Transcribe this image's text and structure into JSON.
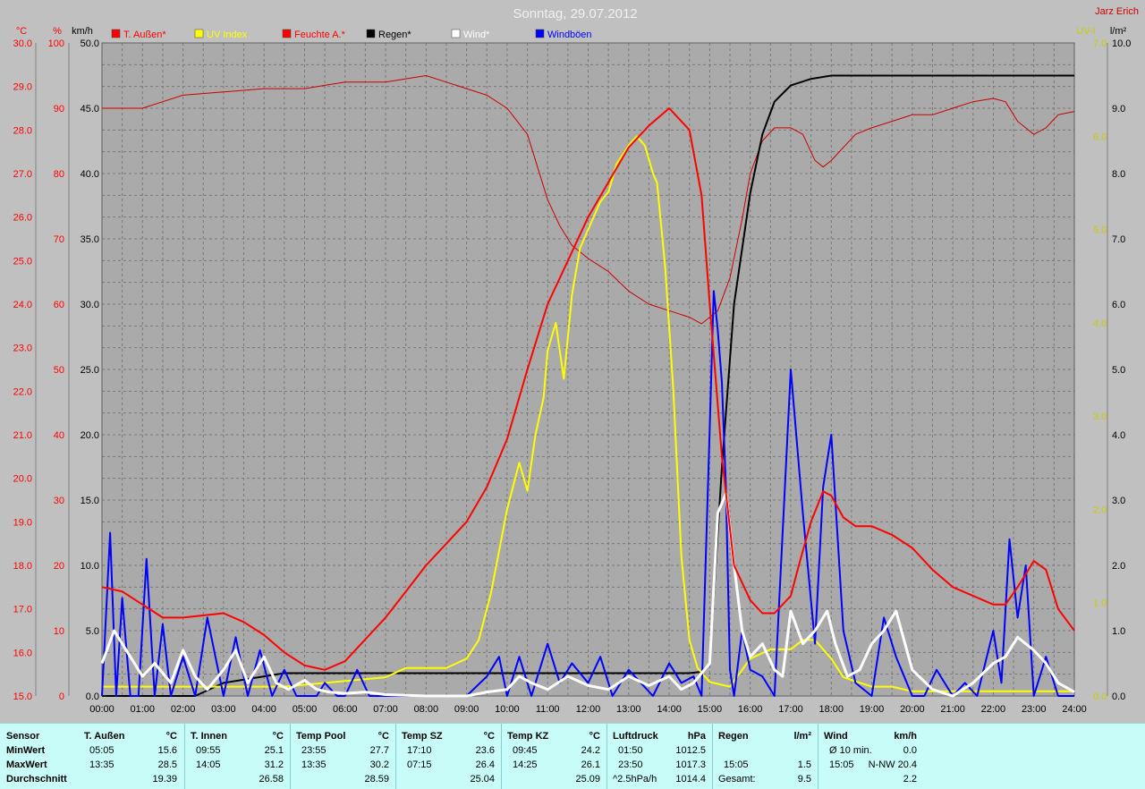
{
  "header": {
    "date_title": "Sonntag, 29.07.2012",
    "author": "Jarz Erich"
  },
  "colors": {
    "temp": "#ff0000",
    "humidity": "#cc0000",
    "uv": "#ffff00",
    "rain": "#000000",
    "wind": "#ffffff",
    "gusts": "#0000ff",
    "plot_bg": "#aaaaaa",
    "page_bg": "#c0c0c0",
    "stats_bg": "#c8fcf8"
  },
  "chart_data": {
    "type": "line",
    "x_unit": "time",
    "x_range": [
      "00:00",
      "24:00"
    ],
    "x_ticks": [
      "00:00",
      "01:00",
      "02:00",
      "03:00",
      "04:00",
      "05:00",
      "06:00",
      "07:00",
      "08:00",
      "09:00",
      "10:00",
      "11:00",
      "12:00",
      "13:00",
      "14:00",
      "15:00",
      "16:00",
      "17:00",
      "18:00",
      "19:00",
      "20:00",
      "21:00",
      "22:00",
      "23:00",
      "24:00"
    ],
    "grid": true,
    "legend_position": "top",
    "axes": {
      "temp": {
        "unit": "°C",
        "range": [
          15,
          30
        ],
        "ticks": [
          "15.0",
          "16.0",
          "17.0",
          "18.0",
          "19.0",
          "20.0",
          "21.0",
          "22.0",
          "23.0",
          "24.0",
          "25.0",
          "26.0",
          "27.0",
          "28.0",
          "29.0",
          "30.0"
        ],
        "color": "#ff0000"
      },
      "humidity": {
        "unit": "%",
        "range": [
          0,
          100
        ],
        "ticks": [
          "0",
          "10",
          "20",
          "30",
          "40",
          "50",
          "60",
          "70",
          "80",
          "90",
          "100"
        ],
        "color": "#ff0000"
      },
      "wind": {
        "unit": "km/h",
        "range": [
          0,
          50
        ],
        "ticks": [
          "0.0",
          "5.0",
          "10.0",
          "15.0",
          "20.0",
          "25.0",
          "30.0",
          "35.0",
          "40.0",
          "45.0",
          "50.0"
        ],
        "color": "#000000"
      },
      "uv": {
        "unit": "UV-I",
        "range": [
          0,
          7
        ],
        "ticks": [
          "0.0",
          "1.0",
          "2.0",
          "3.0",
          "4.0",
          "5.0",
          "6.0",
          "7.0"
        ],
        "color": "#cccc00"
      },
      "rain": {
        "unit": "l/m²",
        "range": [
          0,
          10
        ],
        "ticks": [
          "0.0",
          "1.0",
          "2.0",
          "3.0",
          "4.0",
          "5.0",
          "6.0",
          "7.0",
          "8.0",
          "9.0",
          "10.0"
        ],
        "color": "#000000"
      }
    },
    "legend": [
      {
        "name": "T. Außen*",
        "color": "#ff0000"
      },
      {
        "name": "UV Index",
        "color": "#ffff00"
      },
      {
        "name": "Feuchte A.*",
        "color": "#ff0000"
      },
      {
        "name": "Regen*",
        "color": "#000000"
      },
      {
        "name": "Wind*",
        "color": "#ffffff"
      },
      {
        "name": "Windböen",
        "color": "#0000ff"
      }
    ],
    "series": [
      {
        "name": "T. Außen*",
        "axis": "temp",
        "x": [
          0,
          0.5,
          1,
          1.5,
          2,
          3,
          3.5,
          4,
          4.5,
          5,
          5.5,
          6,
          6.5,
          7,
          7.5,
          8,
          8.5,
          9,
          9.5,
          10,
          10.5,
          11,
          11.5,
          12,
          12.5,
          13,
          13.5,
          14,
          14.5,
          14.8,
          15,
          15.3,
          15.6,
          16,
          16.3,
          16.6,
          17,
          17.2,
          17.5,
          17.8,
          18,
          18.3,
          18.6,
          19,
          19.5,
          20,
          20.5,
          21,
          21.5,
          22,
          22.3,
          22.6,
          23,
          23.3,
          23.6,
          24
        ],
        "y": [
          17.5,
          17.4,
          17.1,
          16.8,
          16.8,
          16.9,
          16.7,
          16.4,
          16.0,
          15.7,
          15.6,
          15.8,
          16.3,
          16.8,
          17.4,
          18.0,
          18.5,
          19.0,
          19.8,
          20.9,
          22.5,
          24.0,
          25.0,
          26.0,
          26.8,
          27.6,
          28.1,
          28.5,
          28.0,
          26.5,
          24.0,
          20.5,
          18.0,
          17.2,
          16.9,
          16.9,
          17.3,
          18.0,
          19.0,
          19.7,
          19.6,
          19.1,
          18.9,
          18.9,
          18.7,
          18.4,
          17.9,
          17.5,
          17.3,
          17.1,
          17.1,
          17.5,
          18.1,
          17.9,
          17.0,
          16.5
        ]
      },
      {
        "name": "Feuchte A.*",
        "axis": "humidity",
        "x": [
          0,
          0.5,
          1,
          1.5,
          2,
          3,
          4,
          5,
          5.5,
          6,
          7,
          8,
          8.5,
          9,
          9.5,
          10,
          10.5,
          11,
          11.3,
          11.6,
          12,
          12.5,
          13,
          13.5,
          14,
          14.5,
          14.8,
          15,
          15.2,
          15.5,
          15.8,
          16,
          16.3,
          16.6,
          17,
          17.3,
          17.6,
          17.8,
          18,
          18.3,
          18.6,
          19,
          19.5,
          20,
          20.5,
          21,
          21.5,
          22,
          22.3,
          22.6,
          23,
          23.3,
          23.6,
          24
        ],
        "y": [
          90,
          90,
          90,
          91,
          92,
          92.5,
          93,
          93,
          93.5,
          94,
          94,
          95,
          94,
          93,
          92,
          90,
          86,
          76,
          72,
          69,
          67,
          65,
          62,
          60,
          59,
          58,
          57,
          58,
          59,
          64,
          73,
          80,
          85,
          87,
          87,
          86,
          82,
          81,
          82,
          84,
          86,
          87,
          88,
          89,
          89,
          90,
          91,
          91.5,
          91,
          88,
          86,
          87,
          89,
          89.5
        ]
      },
      {
        "name": "UV Index",
        "axis": "uv",
        "x": [
          0,
          4.5,
          7,
          7.5,
          8,
          8.5,
          9,
          9.3,
          9.6,
          10,
          10.3,
          10.5,
          10.7,
          10.9,
          11,
          11.2,
          11.4,
          11.6,
          11.8,
          12,
          12.3,
          12.5,
          12.7,
          13,
          13.2,
          13.4,
          13.6,
          13.7,
          13.9,
          14.1,
          14.3,
          14.5,
          14.7,
          15,
          15.5,
          16,
          16.5,
          17,
          17.3,
          17.6,
          18,
          18.3,
          19,
          19.5,
          20,
          24
        ],
        "y": [
          0.1,
          0.1,
          0.2,
          0.3,
          0.3,
          0.3,
          0.4,
          0.6,
          1.1,
          2.0,
          2.5,
          2.2,
          2.8,
          3.2,
          3.7,
          4.0,
          3.4,
          4.3,
          4.8,
          5.0,
          5.3,
          5.4,
          5.7,
          5.9,
          6.0,
          5.9,
          5.6,
          5.5,
          4.6,
          3.3,
          1.5,
          0.6,
          0.3,
          0.15,
          0.1,
          0.4,
          0.5,
          0.5,
          0.6,
          0.6,
          0.4,
          0.2,
          0.1,
          0.1,
          0.05,
          0.05
        ]
      },
      {
        "name": "Regen*",
        "axis": "rain",
        "x": [
          0,
          2.3,
          3,
          4,
          4.5,
          5,
          5.5,
          14.5,
          14.8,
          15.0,
          15.1,
          15.3,
          15.6,
          16,
          16.3,
          16.6,
          17,
          17.5,
          18,
          19,
          20,
          21,
          22,
          23,
          24
        ],
        "y": [
          0,
          0.0,
          0.2,
          0.3,
          0.35,
          0.35,
          0.35,
          0.35,
          0.37,
          0.5,
          1.5,
          3.5,
          6.0,
          7.7,
          8.6,
          9.1,
          9.35,
          9.45,
          9.5,
          9.5,
          9.5,
          9.5,
          9.5,
          9.5,
          9.5
        ]
      },
      {
        "name": "Wind*",
        "axis": "wind",
        "x": [
          0,
          0.3,
          0.7,
          1,
          1.3,
          1.7,
          2,
          2.3,
          2.6,
          3,
          3.3,
          3.6,
          4,
          4.3,
          4.6,
          5,
          5.3,
          5.6,
          6,
          6.5,
          7,
          8,
          9,
          9.5,
          10,
          10.3,
          10.6,
          11,
          11.5,
          12,
          12.5,
          13,
          13.5,
          14,
          14.3,
          14.6,
          15,
          15.2,
          15.4,
          15.6,
          15.8,
          16,
          16.3,
          16.6,
          16.8,
          17,
          17.3,
          17.6,
          17.9,
          18.1,
          18.4,
          18.7,
          19,
          19.3,
          19.6,
          20,
          20.5,
          21,
          21.5,
          22,
          22.3,
          22.6,
          23,
          23.3,
          23.6,
          24
        ],
        "y": [
          2.5,
          5.0,
          3.0,
          1.5,
          2.5,
          1.0,
          3.5,
          1.5,
          0.5,
          2.0,
          3.5,
          1.0,
          3.0,
          1.0,
          0.5,
          1.2,
          0.5,
          0.3,
          0.2,
          0.3,
          0.1,
          0.0,
          0.0,
          0.3,
          0.5,
          1.5,
          1.0,
          0.5,
          1.5,
          0.8,
          0.5,
          1.5,
          0.8,
          1.5,
          0.5,
          1.0,
          2.5,
          14.0,
          15.5,
          10.0,
          5.0,
          3.0,
          4.0,
          2.0,
          1.5,
          6.5,
          4.0,
          5.0,
          6.5,
          4.0,
          1.5,
          2.0,
          4.0,
          5.0,
          6.5,
          2.0,
          0.5,
          0.0,
          1.0,
          2.5,
          3.0,
          4.5,
          3.5,
          2.5,
          1.0,
          0.3
        ]
      },
      {
        "name": "Windböen",
        "axis": "wind",
        "x": [
          0,
          0.2,
          0.35,
          0.5,
          0.7,
          0.9,
          1.1,
          1.3,
          1.5,
          1.7,
          2,
          2.3,
          2.6,
          3,
          3.3,
          3.6,
          3.9,
          4.2,
          4.5,
          4.8,
          5,
          5.3,
          5.5,
          5.8,
          6,
          6.3,
          6.6,
          7,
          8,
          9,
          9.5,
          9.8,
          10,
          10.3,
          10.6,
          11,
          11.3,
          11.6,
          12,
          12.3,
          12.6,
          13,
          13.3,
          13.6,
          14,
          14.3,
          14.6,
          14.8,
          15,
          15.1,
          15.2,
          15.3,
          15.4,
          15.5,
          15.6,
          15.8,
          16,
          16.3,
          16.6,
          17,
          17.3,
          17.6,
          17.8,
          18,
          18.3,
          18.6,
          19,
          19.3,
          19.6,
          20,
          20.3,
          20.6,
          21,
          21.3,
          21.6,
          22,
          22.2,
          22.4,
          22.6,
          22.8,
          23,
          23.3,
          23.6,
          24
        ],
        "y": [
          0,
          12.5,
          0,
          7.5,
          0,
          0,
          10.5,
          0,
          5.5,
          0,
          3,
          0,
          6,
          0,
          4.5,
          0,
          3.5,
          0,
          2,
          0,
          0,
          0,
          1,
          0,
          0,
          2,
          0,
          0,
          0,
          0,
          1.5,
          3,
          0,
          3,
          0,
          4,
          1,
          2.5,
          1,
          3,
          0,
          2,
          1,
          0,
          2.5,
          1,
          1.5,
          0,
          20.5,
          31,
          28,
          24,
          16,
          2,
          0,
          5,
          2,
          1.5,
          0,
          25,
          14,
          4,
          16,
          20,
          5,
          1,
          0,
          6,
          3,
          0,
          0,
          2,
          0,
          1,
          0,
          5,
          1,
          12,
          6,
          10,
          0,
          3,
          0,
          0
        ]
      }
    ]
  },
  "stats": {
    "row_labels": [
      "Sensor",
      "MinWert",
      "MaxWert",
      "Durchschnitt"
    ],
    "blocks": [
      {
        "title": "T. Außen",
        "unit": "°C",
        "min_time": "05:05",
        "min_val": "15.6",
        "max_time": "13:35",
        "max_val": "28.5",
        "avg_label": "",
        "avg_val": "19.39"
      },
      {
        "title": "T. Innen",
        "unit": "°C",
        "min_time": "09:55",
        "min_val": "25.1",
        "max_time": "14:05",
        "max_val": "31.2",
        "avg_label": "",
        "avg_val": "26.58"
      },
      {
        "title": "Temp Pool",
        "unit": "°C",
        "min_time": "23:55",
        "min_val": "27.7",
        "max_time": "13:35",
        "max_val": "30.2",
        "avg_label": "",
        "avg_val": "28.59"
      },
      {
        "title": "Temp SZ",
        "unit": "°C",
        "min_time": "17:10",
        "min_val": "23.6",
        "max_time": "07:15",
        "max_val": "26.4",
        "avg_label": "",
        "avg_val": "25.04"
      },
      {
        "title": "Temp KZ",
        "unit": "°C",
        "min_time": "09:45",
        "min_val": "24.2",
        "max_time": "14:25",
        "max_val": "26.1",
        "avg_label": "",
        "avg_val": "25.09"
      },
      {
        "title": "Luftdruck",
        "unit": "hPa",
        "min_time": "01:50",
        "min_val": "1012.5",
        "max_time": "23:50",
        "max_val": "1017.3",
        "avg_label": "^2.5hPa/h",
        "avg_val": "1014.4"
      },
      {
        "title": "Regen",
        "unit": "l/m²",
        "min_time": "",
        "min_val": "",
        "max_time": "15:05",
        "max_val": "1.5",
        "avg_label": "Gesamt:",
        "avg_val": "9.5"
      },
      {
        "title": "Wind",
        "unit": "km/h",
        "min_time": "Ø 10 min.",
        "min_val": "0.0",
        "max_time": "15:05",
        "max_val": "N-NW 20.4",
        "avg_label": "",
        "avg_val": "2.2"
      }
    ]
  }
}
